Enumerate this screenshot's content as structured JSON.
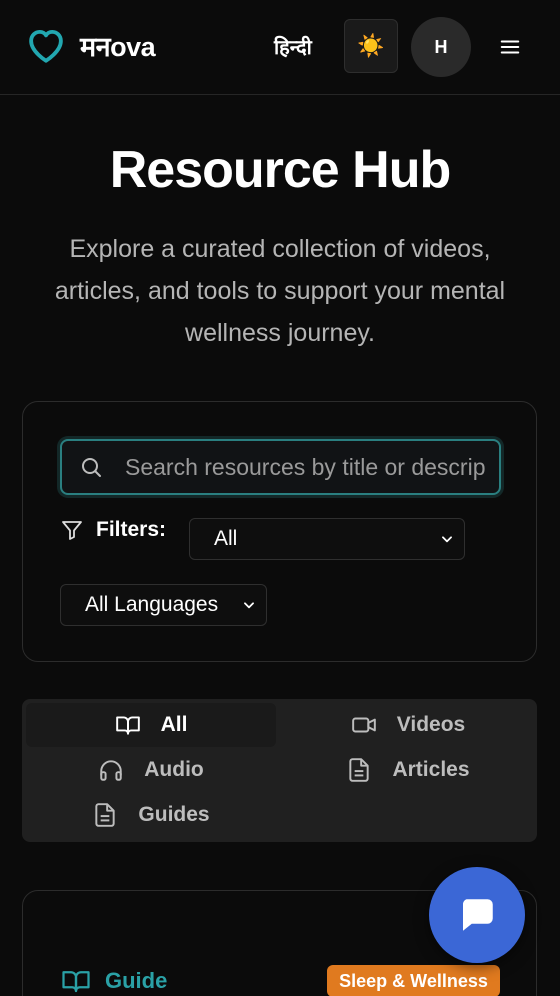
{
  "header": {
    "logo_text": "मनova",
    "language_toggle": "हिन्दी",
    "theme_icon": "sun-icon",
    "theme_glyph": "☀️",
    "avatar_initial": "H",
    "menu_icon": "hamburger-icon",
    "accent_color": "#22a7b0"
  },
  "hero": {
    "title": "Resource Hub",
    "subtitle": "Explore a curated collection of videos, articles, and tools to support your mental wellness journey."
  },
  "filters": {
    "search_placeholder": "Search resources by title or description...",
    "search_value": "",
    "filters_label": "Filters:",
    "category_selected": "All",
    "language_selected": "All Languages"
  },
  "tabs": [
    {
      "label": "All",
      "icon": "book-open-icon",
      "active": true
    },
    {
      "label": "Videos",
      "icon": "video-icon",
      "active": false
    },
    {
      "label": "Audio",
      "icon": "headphones-icon",
      "active": false
    },
    {
      "label": "Articles",
      "icon": "file-text-icon",
      "active": false
    },
    {
      "label": "Guides",
      "icon": "file-text-icon",
      "active": false
    }
  ],
  "resource_card": {
    "type_label": "Guide",
    "type_icon": "book-open-icon",
    "category_badge": "Sleep & Wellness",
    "badge_color": "#e07a1f"
  },
  "chat": {
    "icon": "chat-bubble-icon",
    "color": "#3b67d6"
  }
}
